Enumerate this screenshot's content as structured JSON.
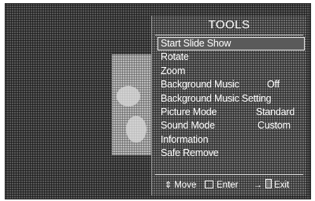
{
  "menu": {
    "title": "TOOLS",
    "items": [
      {
        "label": "Start Slide Show",
        "value": null,
        "selected": true
      },
      {
        "label": "Rotate",
        "value": null
      },
      {
        "label": "Zoom",
        "value": null
      },
      {
        "label": "Background Music",
        "value": "Off"
      },
      {
        "label": "Background Music Setting",
        "value": null
      },
      {
        "label": "Picture Mode",
        "value": "Standard"
      },
      {
        "label": "Sound Mode",
        "value": "Custom"
      },
      {
        "label": "Information",
        "value": null
      },
      {
        "label": "Safe Remove",
        "value": null
      }
    ]
  },
  "footer": {
    "move_label": "Move",
    "enter_label": "Enter",
    "exit_label": "Exit",
    "move_icon": "up-down-arrows-icon",
    "enter_icon": "enter-icon",
    "exit_icon": "exit-icon"
  }
}
